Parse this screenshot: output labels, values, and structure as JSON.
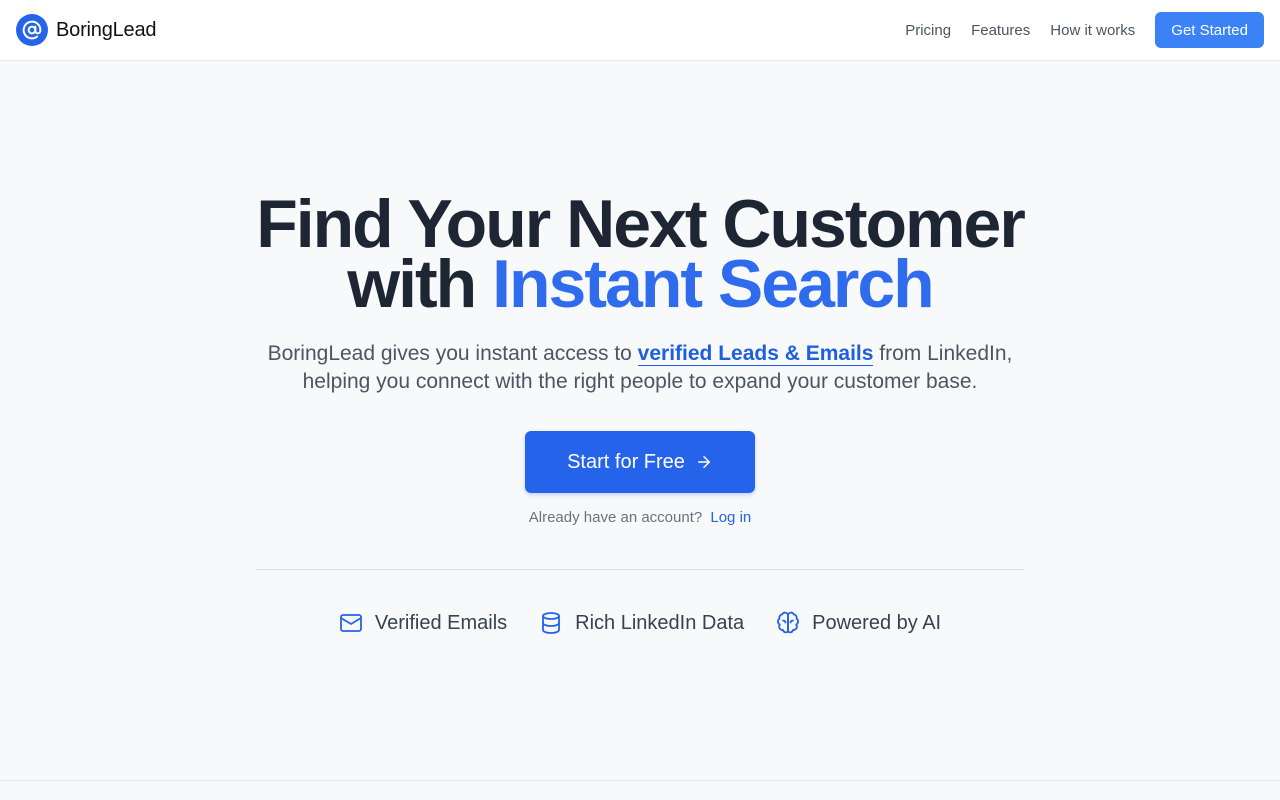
{
  "nav": {
    "brand": "BoringLead",
    "brand_icon": "at-sign-icon",
    "links": [
      "Pricing",
      "Features",
      "How it works"
    ],
    "cta_label": "Get Started"
  },
  "hero": {
    "headline_line1": "Find Your Next Customer",
    "headline_prefix": "with",
    "headline_accent": "Instant Search",
    "subtitle_before": "BoringLead gives you instant access to",
    "subtitle_highlight": "verified Leads & Emails",
    "subtitle_after": "from LinkedIn,",
    "subtitle_line2": "helping you connect with the right people to expand your customer base.",
    "cta_label": "Start for Free",
    "cta_icon": "arrow-right-icon",
    "login_prompt": "Already have an account?",
    "login_link": "Log in"
  },
  "features": [
    {
      "label": "Verified Emails",
      "icon": "mail-icon"
    },
    {
      "label": "Rich LinkedIn Data",
      "icon": "database-icon"
    },
    {
      "label": "Powered by AI",
      "icon": "brain-icon"
    }
  ],
  "colors": {
    "primary": "#2563eb",
    "nav_cta": "#3b82f6",
    "accent_text": "#2f6bed",
    "heading": "#1e2533",
    "body_text": "#4b5563",
    "background": "#f8f9fb"
  }
}
